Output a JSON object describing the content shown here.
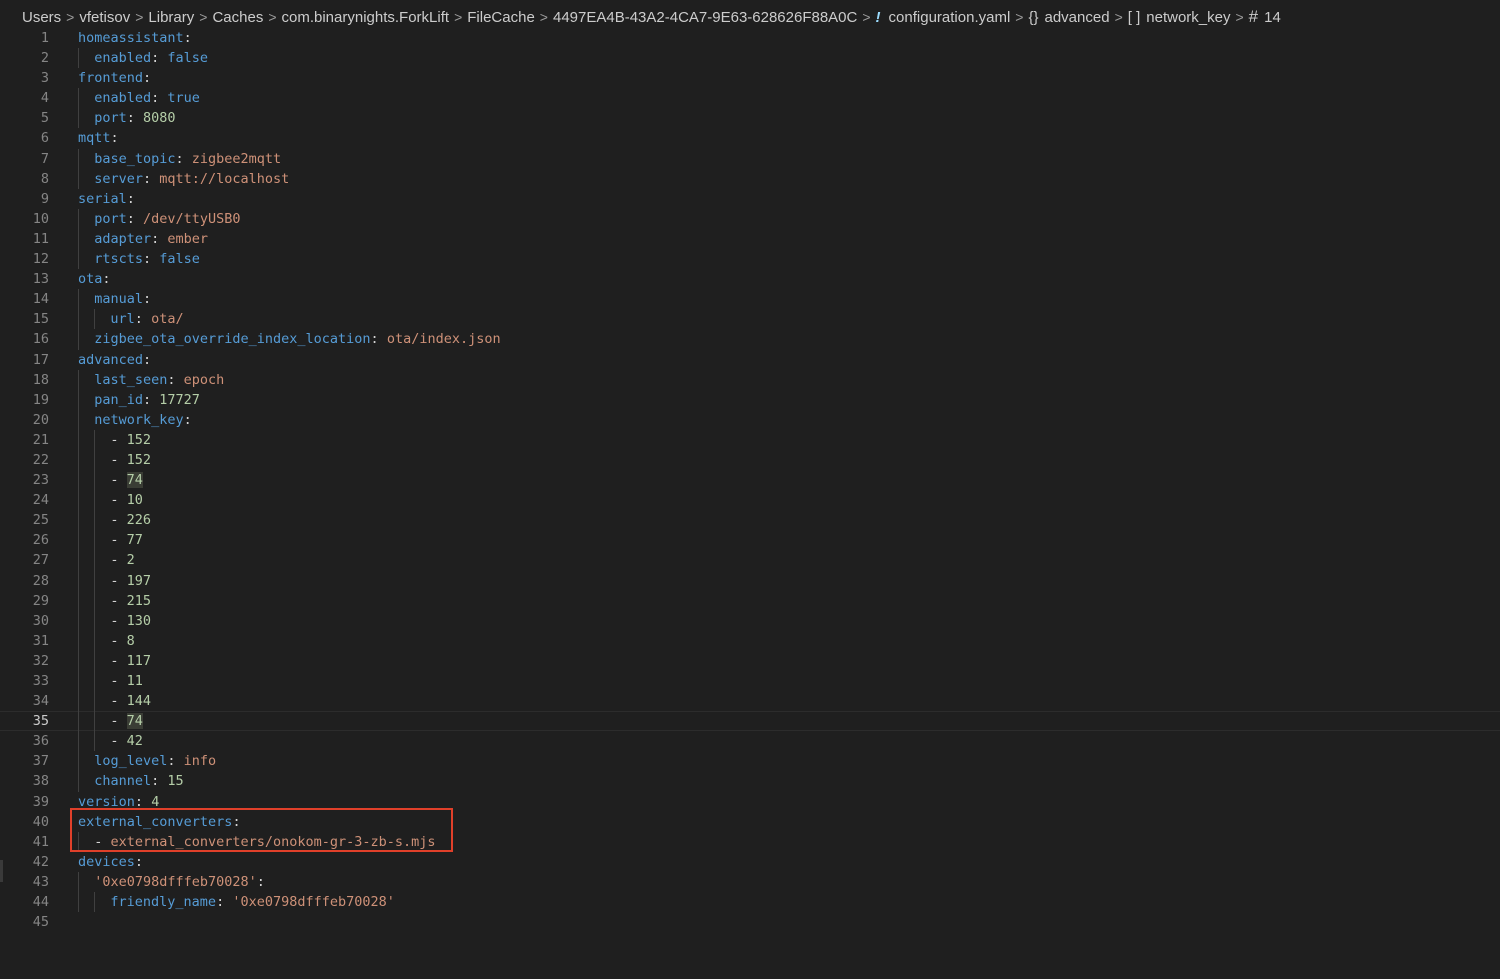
{
  "breadcrumb": {
    "items": [
      "Users",
      "vfetisov",
      "Library",
      "Caches",
      "com.binarynights.ForkLift",
      "FileCache",
      "4497EA4B-43A2-4CA7-9E63-628626F88A0C"
    ],
    "file_icon": "!",
    "file": "configuration.yaml",
    "obj_icon": "{}",
    "obj": "advanced",
    "arr_icon": "[ ]",
    "arr": "network_key",
    "num_icon": "#",
    "num": "14",
    "separator": ">"
  },
  "editor": {
    "current_line": 35,
    "lines": [
      {
        "n": "1",
        "indent": 0,
        "key": "homeassistant",
        "value": "",
        "vtype": ""
      },
      {
        "n": "2",
        "indent": 1,
        "key": "enabled",
        "value": "false",
        "vtype": "bool"
      },
      {
        "n": "3",
        "indent": 0,
        "key": "frontend",
        "value": "",
        "vtype": ""
      },
      {
        "n": "4",
        "indent": 1,
        "key": "enabled",
        "value": "true",
        "vtype": "bool"
      },
      {
        "n": "5",
        "indent": 1,
        "key": "port",
        "value": "8080",
        "vtype": "num"
      },
      {
        "n": "6",
        "indent": 0,
        "key": "mqtt",
        "value": "",
        "vtype": ""
      },
      {
        "n": "7",
        "indent": 1,
        "key": "base_topic",
        "value": "zigbee2mqtt",
        "vtype": "str"
      },
      {
        "n": "8",
        "indent": 1,
        "key": "server",
        "value": "mqtt://localhost",
        "vtype": "str"
      },
      {
        "n": "9",
        "indent": 0,
        "key": "serial",
        "value": "",
        "vtype": ""
      },
      {
        "n": "10",
        "indent": 1,
        "key": "port",
        "value": "/dev/ttyUSB0",
        "vtype": "str"
      },
      {
        "n": "11",
        "indent": 1,
        "key": "adapter",
        "value": "ember",
        "vtype": "str"
      },
      {
        "n": "12",
        "indent": 1,
        "key": "rtscts",
        "value": "false",
        "vtype": "bool"
      },
      {
        "n": "13",
        "indent": 0,
        "key": "ota",
        "value": "",
        "vtype": ""
      },
      {
        "n": "14",
        "indent": 1,
        "key": "manual",
        "value": "",
        "vtype": ""
      },
      {
        "n": "15",
        "indent": 2,
        "key": "url",
        "value": "ota/",
        "vtype": "str"
      },
      {
        "n": "16",
        "indent": 1,
        "key": "zigbee_ota_override_index_location",
        "value": "ota/index.json",
        "vtype": "str"
      },
      {
        "n": "17",
        "indent": 0,
        "key": "advanced",
        "value": "",
        "vtype": ""
      },
      {
        "n": "18",
        "indent": 1,
        "key": "last_seen",
        "value": "epoch",
        "vtype": "str"
      },
      {
        "n": "19",
        "indent": 1,
        "key": "pan_id",
        "value": "17727",
        "vtype": "num"
      },
      {
        "n": "20",
        "indent": 1,
        "key": "network_key",
        "value": "",
        "vtype": ""
      },
      {
        "n": "21",
        "indent": 2,
        "item": "152",
        "vtype": "num"
      },
      {
        "n": "22",
        "indent": 2,
        "item": "152",
        "vtype": "num"
      },
      {
        "n": "23",
        "indent": 2,
        "item": "74",
        "vtype": "num",
        "hl": true
      },
      {
        "n": "24",
        "indent": 2,
        "item": "10",
        "vtype": "num"
      },
      {
        "n": "25",
        "indent": 2,
        "item": "226",
        "vtype": "num"
      },
      {
        "n": "26",
        "indent": 2,
        "item": "77",
        "vtype": "num"
      },
      {
        "n": "27",
        "indent": 2,
        "item": "2",
        "vtype": "num"
      },
      {
        "n": "28",
        "indent": 2,
        "item": "197",
        "vtype": "num"
      },
      {
        "n": "29",
        "indent": 2,
        "item": "215",
        "vtype": "num"
      },
      {
        "n": "30",
        "indent": 2,
        "item": "130",
        "vtype": "num"
      },
      {
        "n": "31",
        "indent": 2,
        "item": "8",
        "vtype": "num"
      },
      {
        "n": "32",
        "indent": 2,
        "item": "117",
        "vtype": "num"
      },
      {
        "n": "33",
        "indent": 2,
        "item": "11",
        "vtype": "num"
      },
      {
        "n": "34",
        "indent": 2,
        "item": "144",
        "vtype": "num"
      },
      {
        "n": "35",
        "indent": 2,
        "item": "74",
        "vtype": "num",
        "hl": true
      },
      {
        "n": "36",
        "indent": 2,
        "item": "42",
        "vtype": "num"
      },
      {
        "n": "37",
        "indent": 1,
        "key": "log_level",
        "value": "info",
        "vtype": "str"
      },
      {
        "n": "38",
        "indent": 1,
        "key": "channel",
        "value": "15",
        "vtype": "num"
      },
      {
        "n": "39",
        "indent": 0,
        "key": "version",
        "value": "4",
        "vtype": "num"
      },
      {
        "n": "40",
        "indent": 0,
        "key": "external_converters",
        "value": "",
        "vtype": ""
      },
      {
        "n": "41",
        "indent": 1,
        "item": "external_converters/onokom-gr-3-zb-s.mjs",
        "vtype": "str",
        "itemIndentOffset": -1
      },
      {
        "n": "42",
        "indent": 0,
        "key": "devices",
        "value": "",
        "vtype": ""
      },
      {
        "n": "43",
        "indent": 1,
        "key": "'0xe0798dfffeb70028'",
        "value": "",
        "vtype": "",
        "keytype": "str"
      },
      {
        "n": "44",
        "indent": 2,
        "key": "friendly_name",
        "value": "'0xe0798dfffeb70028'",
        "vtype": "str"
      },
      {
        "n": "45",
        "indent": 0,
        "key": "",
        "value": "",
        "vtype": ""
      }
    ]
  }
}
